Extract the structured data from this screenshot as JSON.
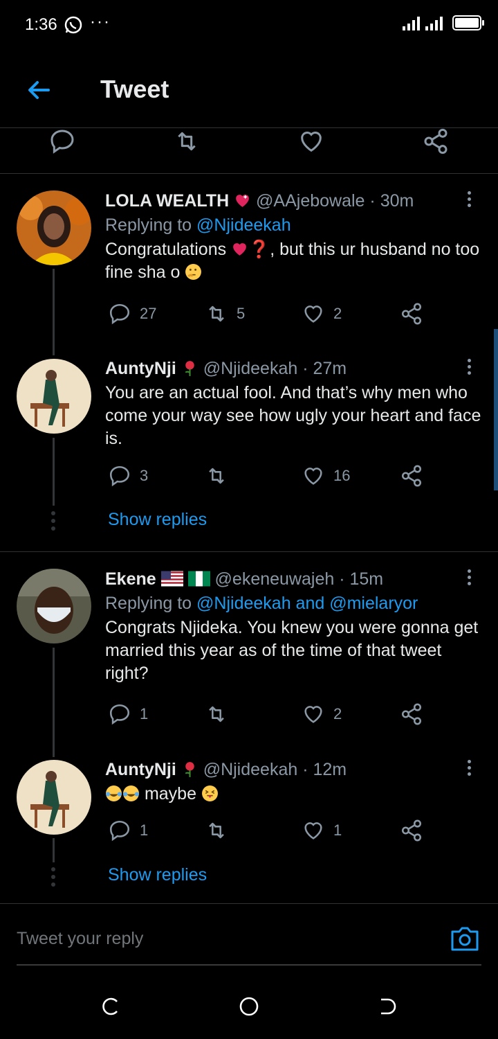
{
  "status_bar": {
    "time": "1:36",
    "dots": "···"
  },
  "header": {
    "title": "Tweet"
  },
  "tweets": [
    {
      "name": "LOLA WEALTH",
      "handle": "@AAjebowale",
      "time": "· 30m",
      "replying_prefix": "Replying to",
      "replying_to": "@Njideekah",
      "text_part1": "Congratulations ",
      "text_part2": "❓, but this ur husband no too fine sha o ",
      "replies": "27",
      "retweets": "5",
      "likes": "2"
    },
    {
      "name": "AuntyNji",
      "handle": "@Njideekah",
      "time": "· 27m",
      "text": "You are an actual fool. And that’s why men who come your way see how ugly your heart and face is.",
      "replies": "3",
      "retweets": "",
      "likes": "16",
      "show_replies": "Show replies"
    },
    {
      "name": "Ekene",
      "handle": "@ekeneuwajeh",
      "time": "· 15m",
      "replying_prefix": "Replying to",
      "replying_to": "@Njideekah and @mielaryor",
      "text": "Congrats Njideka. You knew you were gonna get married this year as of the time of that tweet right?",
      "replies": "1",
      "retweets": "",
      "likes": "2"
    },
    {
      "name": "AuntyNji",
      "handle": "@Njideekah",
      "time": "· 12m",
      "text": "maybe",
      "replies": "1",
      "retweets": "",
      "likes": "1",
      "show_replies": "Show replies"
    }
  ],
  "reply_bar": {
    "placeholder": "Tweet your reply"
  },
  "colors": {
    "background": "#000000",
    "accent": "#1d9bf0",
    "muted": "#8b98a5",
    "divider": "#2f3336"
  }
}
